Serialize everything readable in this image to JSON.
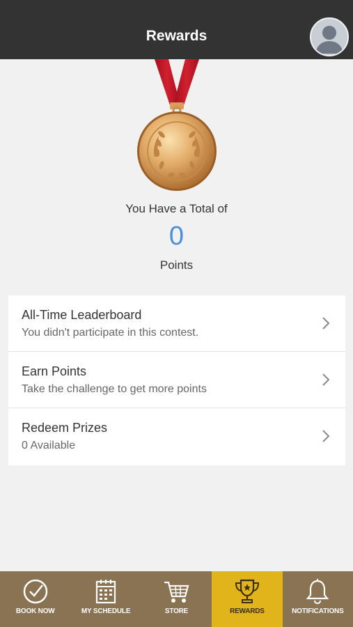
{
  "header": {
    "title": "Rewards",
    "avatar_icon": "user-avatar-icon"
  },
  "summary": {
    "total_label": "You Have a Total of",
    "points": "0",
    "points_label": "Points",
    "medal_icon": "gold-medal-icon"
  },
  "menu": [
    {
      "title": "All-Time Leaderboard",
      "subtitle": "You didn't participate in this contest."
    },
    {
      "title": "Earn Points",
      "subtitle": "Take the challenge to get more points"
    },
    {
      "title": "Redeem Prizes",
      "subtitle": "0 Available"
    }
  ],
  "tabs": [
    {
      "label": "BOOK NOW",
      "icon": "check-circle-icon",
      "active": false
    },
    {
      "label": "MY SCHEDULE",
      "icon": "calendar-icon",
      "active": false
    },
    {
      "label": "STORE",
      "icon": "cart-icon",
      "active": false
    },
    {
      "label": "REWARDS",
      "icon": "trophy-icon",
      "active": true
    },
    {
      "label": "NOTIFICATIONS",
      "icon": "bell-icon",
      "active": false
    }
  ],
  "colors": {
    "header_bg": "#333333",
    "points_blue": "#4a90d9",
    "tabbar_bg": "#8a7352",
    "tab_active_bg": "#e0b41a",
    "ribbon_red": "#c0182b"
  }
}
